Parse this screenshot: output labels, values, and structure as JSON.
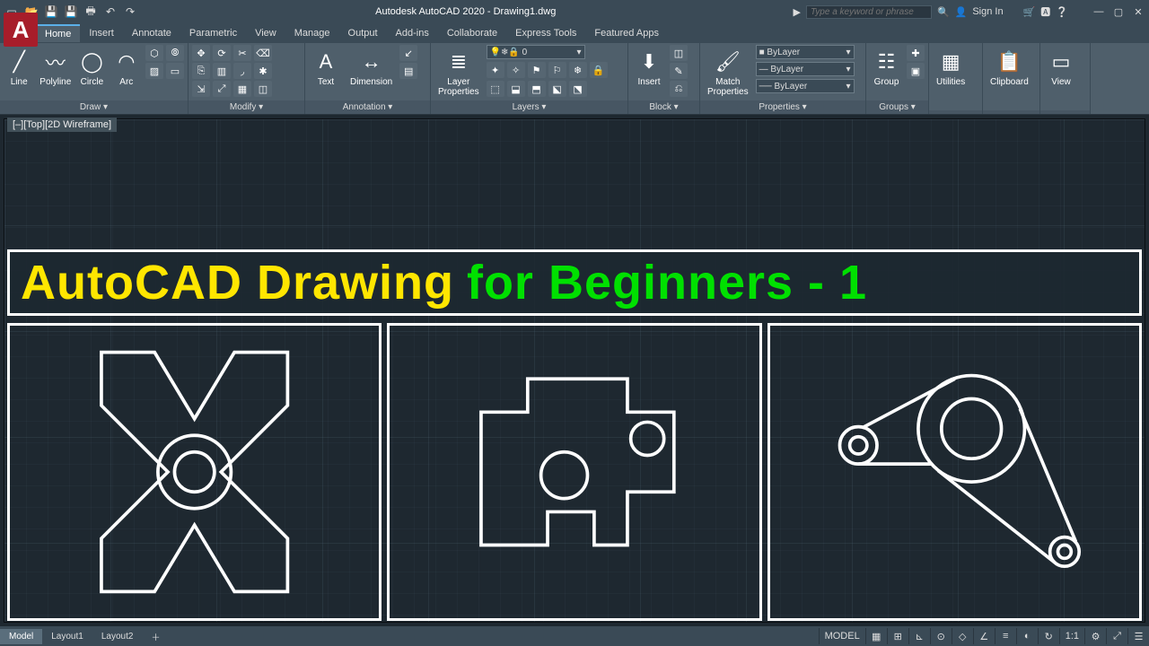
{
  "title": "Autodesk AutoCAD 2020 - Drawing1.dwg",
  "search_placeholder": "Type a keyword or phrase",
  "signin": "Sign In",
  "tabs": [
    "Home",
    "Insert",
    "Annotate",
    "Parametric",
    "View",
    "Manage",
    "Output",
    "Add-ins",
    "Collaborate",
    "Express Tools",
    "Featured Apps"
  ],
  "active_tab": "Home",
  "ribbon": {
    "draw": {
      "title": "Draw ▾",
      "line": "Line",
      "polyline": "Polyline",
      "circle": "Circle",
      "arc": "Arc"
    },
    "modify": {
      "title": "Modify ▾"
    },
    "annotation": {
      "title": "Annotation ▾",
      "text": "Text",
      "dimension": "Dimension"
    },
    "layers": {
      "title": "Layers ▾",
      "layerprops": "Layer\nProperties",
      "current": "0"
    },
    "block": {
      "title": "Block ▾",
      "insert": "Insert"
    },
    "properties": {
      "title": "Properties ▾",
      "match": "Match\nProperties",
      "sel": "ByLayer"
    },
    "groups": {
      "title": "Groups ▾",
      "group": "Group"
    },
    "utilities": {
      "title": "Utilities"
    },
    "clipboard": {
      "title": "Clipboard"
    },
    "view": {
      "title": "View"
    }
  },
  "viewport_label": "[–][Top][2D Wireframe]",
  "banner": {
    "part1": "AutoCAD Drawing",
    "part2": "for Beginners - 1"
  },
  "statusbar": {
    "model": "Model",
    "layout1": "Layout1",
    "layout2": "Layout2",
    "right_label_model": "MODEL",
    "scale": "1:1"
  }
}
